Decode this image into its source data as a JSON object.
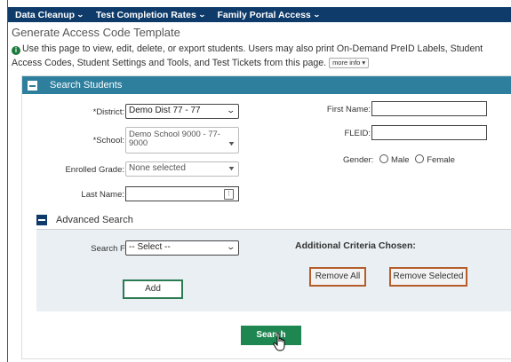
{
  "nav": {
    "items": [
      {
        "label": "Data Cleanup"
      },
      {
        "label": "Test Completion Rates"
      },
      {
        "label": "Family Portal Access"
      }
    ]
  },
  "page": {
    "title": "Generate Access Code Template",
    "description": "Use this page to view, edit, delete, or export students. Users may also print On-Demand PreID Labels, Student Access Codes, Student Settings and Tools, and Test Tickets from this page.",
    "more_info": "more info"
  },
  "search_panel": {
    "title": "Search Students",
    "district": {
      "label": "*District:",
      "value": "Demo Dist 77 - 77"
    },
    "school": {
      "label": "*School:",
      "value_line1": "Demo School 9000 - 77-",
      "value_line2": "9000"
    },
    "enrolled_grade": {
      "label": "Enrolled Grade:",
      "value": "None selected"
    },
    "last_name": {
      "label": "Last Name:",
      "value": ""
    },
    "first_name": {
      "label": "First Name:",
      "value": ""
    },
    "fleid": {
      "label": "FLEID:",
      "value": ""
    },
    "gender": {
      "label": "Gender:",
      "options": [
        "Male",
        "Female"
      ]
    }
  },
  "advanced": {
    "title": "Advanced Search",
    "search_fields_label": "Search Fields:",
    "search_fields_value": "-- Select --",
    "add_label": "Add",
    "criteria_title": "Additional Criteria Chosen:",
    "remove_all_label": "Remove All",
    "remove_selected_label": "Remove Selected"
  },
  "search_button_label": "Search",
  "colors": {
    "nav_bg": "#0e3b6a",
    "panel_header": "#2e7f9e",
    "primary_button": "#1e8650",
    "remove_border": "#b55e2b"
  }
}
